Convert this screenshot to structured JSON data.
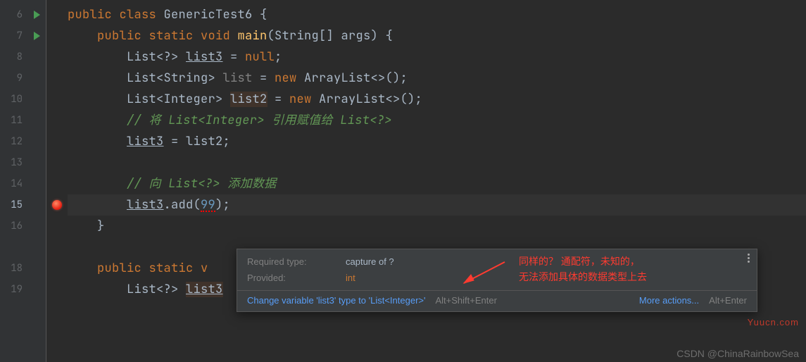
{
  "line_numbers": [
    "6",
    "7",
    "8",
    "9",
    "10",
    "11",
    "12",
    "13",
    "14",
    "15",
    "16",
    "",
    "18",
    "19"
  ],
  "active_line_index": 9,
  "code": {
    "l6": {
      "kw1": "public",
      "kw2": "class",
      "name": "GenericTest6",
      "br": "{"
    },
    "l7": {
      "kw1": "public",
      "kw2": "static",
      "kw3": "void",
      "m": "main",
      "sig": "(String[] args) {"
    },
    "l8": {
      "t": "List",
      "w": "<?>",
      "v": "list3",
      "rest": " = ",
      "kw": "null",
      "end": ";"
    },
    "l9": {
      "t": "List",
      "g": "<String>",
      "v": "list",
      "rest": " = ",
      "kw": "new",
      "c": "ArrayList",
      "diamond": "<>",
      "end": "();"
    },
    "l10": {
      "t": "List",
      "g": "<Integer>",
      "v": "list2",
      "rest": " = ",
      "kw": "new",
      "c": "ArrayList",
      "diamond": "<>",
      "end": "();"
    },
    "l11": {
      "c1": "// 将 List<Integer> 引用赋值给 List<?>"
    },
    "l12": {
      "v": "list3",
      "rest": " = list2;"
    },
    "l14": {
      "c1": "// 向 List<?> 添加数据"
    },
    "l15": {
      "v": "list3",
      "dot": ".",
      "m": "add",
      "p": "(",
      "n": "99",
      "close": ");"
    },
    "l16": "}",
    "l18": {
      "kw1": "public",
      "kw2": "static",
      "kw3": "v"
    },
    "l19": {
      "t": "List",
      "w": "<?>",
      "v": "list3",
      "rest": ""
    }
  },
  "popup": {
    "required_label": "Required type:",
    "required_value": "capture of ?",
    "provided_label": "Provided:",
    "provided_value": "int",
    "quickfix": "Change variable 'list3' type to 'List<Integer>'",
    "shortcut1": "Alt+Shift+Enter",
    "more": "More actions...",
    "shortcut2": "Alt+Enter"
  },
  "annotation": {
    "line1": "同样的？ 通配符，未知的，",
    "line2": "无法添加具体的数据类型上去"
  },
  "watermark_site": "Yuucn.com",
  "watermark_csdn": "CSDN @ChinaRainbowSea"
}
